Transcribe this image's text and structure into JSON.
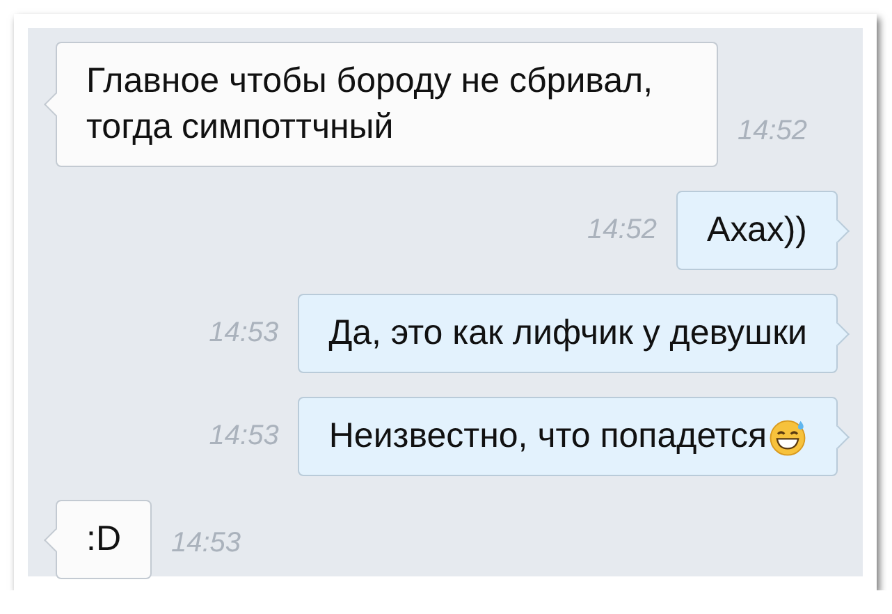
{
  "messages": [
    {
      "kind": "incoming",
      "text": "Главное чтобы бороду не сбривал, тогда симпоттчный",
      "time": "14:52",
      "emoji": false
    },
    {
      "kind": "outgoing",
      "text": "Ахах))",
      "time": "14:52",
      "emoji": false
    },
    {
      "kind": "outgoing",
      "text": "Да, это как лифчик у девушки",
      "time": "14:53",
      "emoji": false
    },
    {
      "kind": "outgoing",
      "text": "Неизвестно, что попадется",
      "time": "14:53",
      "emoji": true
    },
    {
      "kind": "incoming",
      "text": ":D",
      "time": "14:53",
      "emoji": false
    }
  ]
}
